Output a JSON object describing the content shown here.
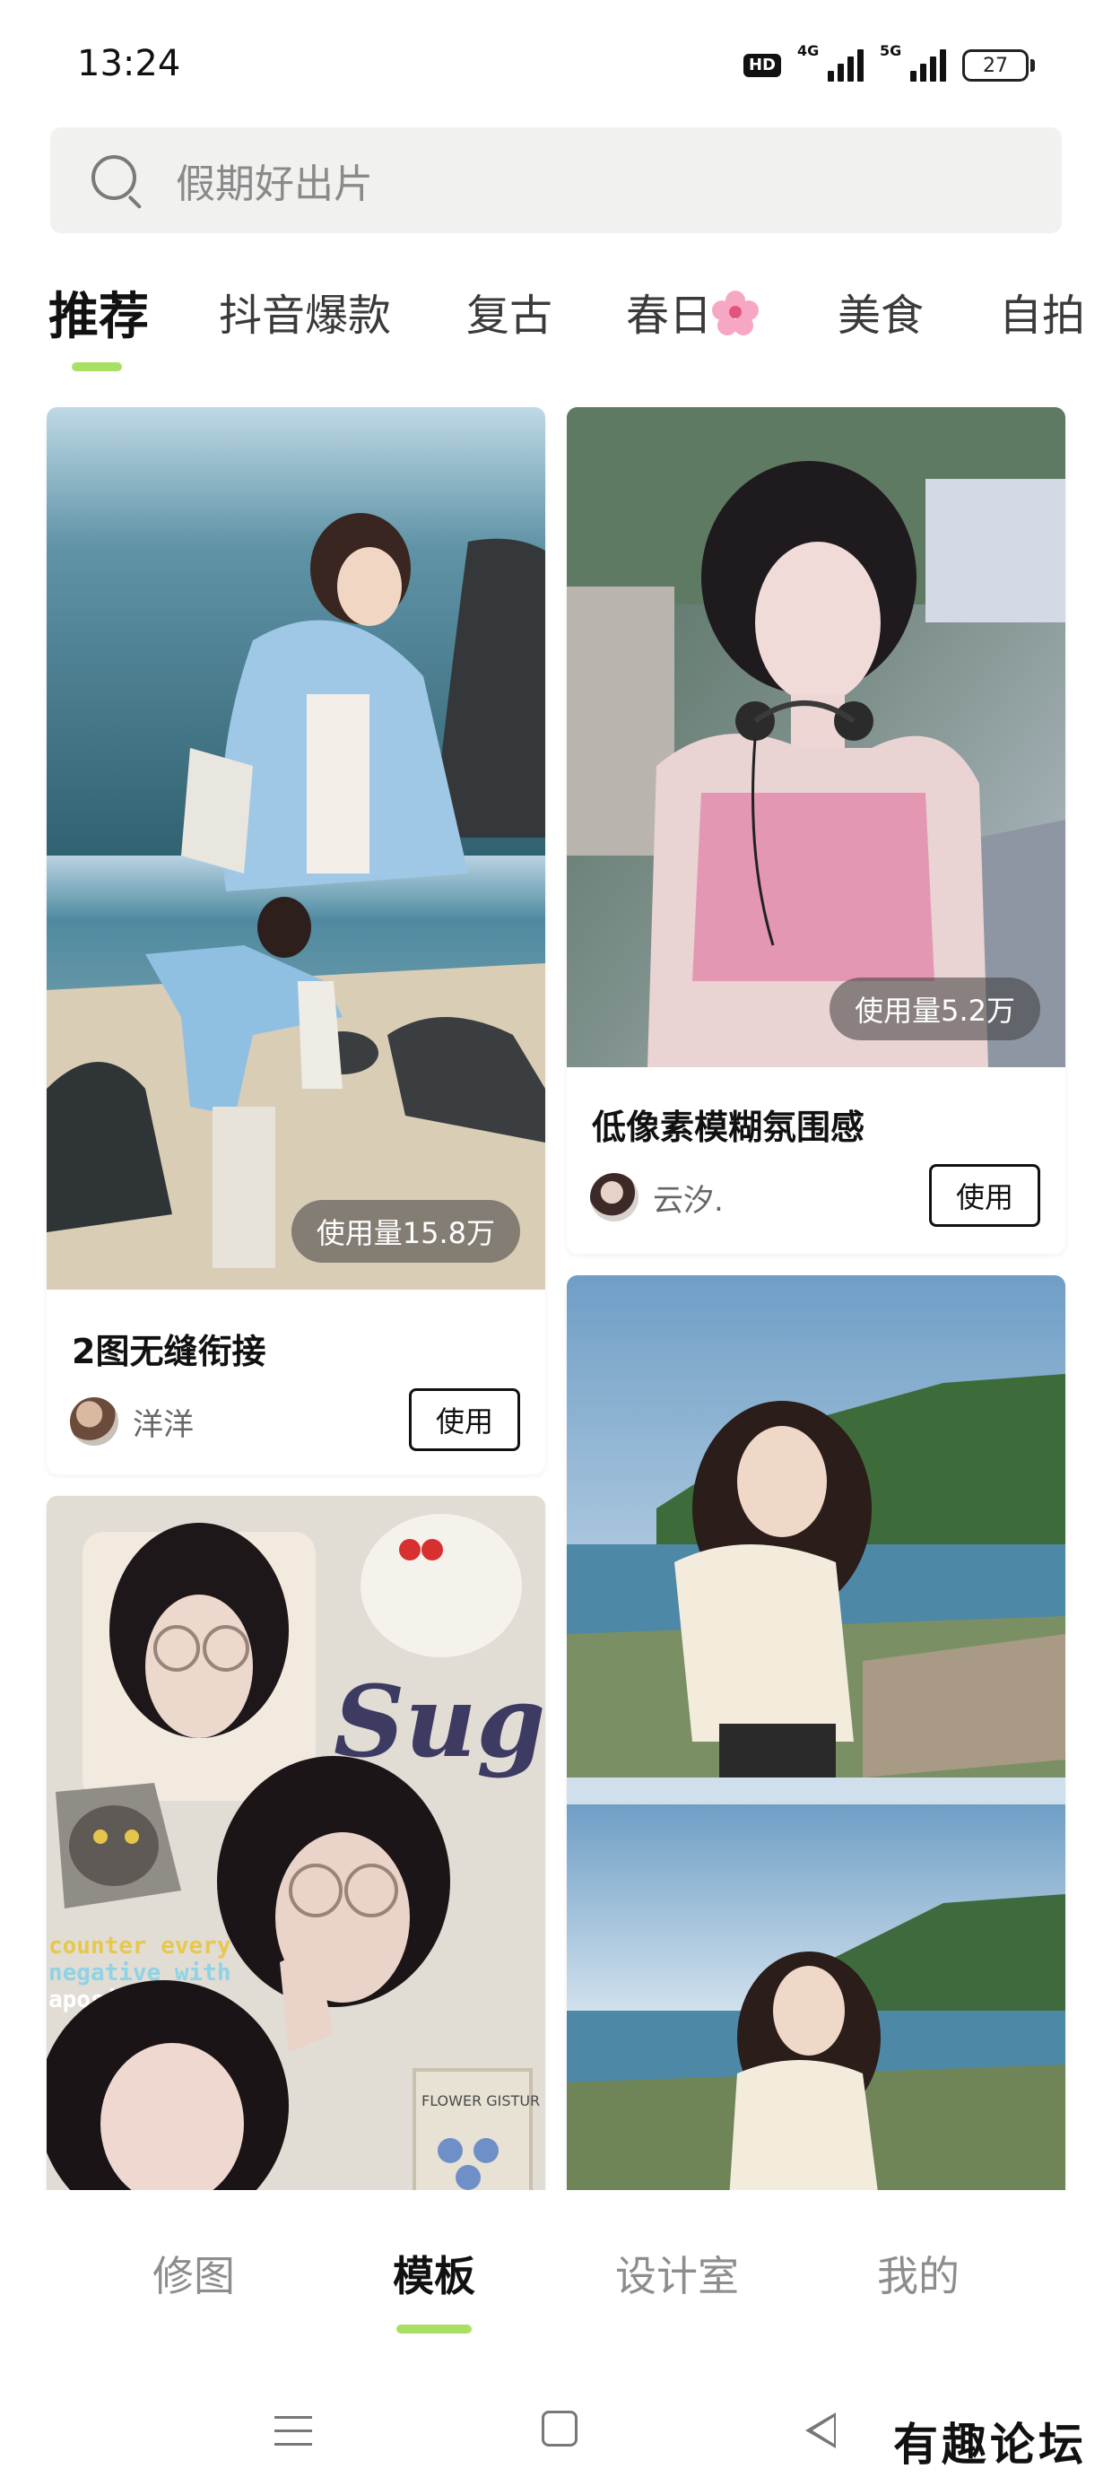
{
  "status_bar": {
    "time": "13:24",
    "hd_label": "HD",
    "network_1": "4G",
    "network_2": "5G",
    "battery": "27"
  },
  "search": {
    "placeholder": "假期好出片",
    "icon": "search-icon"
  },
  "tabs": [
    {
      "label": "推荐",
      "active": true
    },
    {
      "label": "抖音爆款"
    },
    {
      "label": "复古"
    },
    {
      "label": "春日",
      "emoji": "cherry-blossom-icon"
    },
    {
      "label": "美食"
    },
    {
      "label": "自拍"
    }
  ],
  "feed": {
    "cards": [
      {
        "usage": "使用量15.8万",
        "title": "2图无缝衔接",
        "author": "洋洋",
        "button": "使用"
      },
      {
        "usage": "使用量5.2万",
        "title": "低像素模糊氛围感",
        "author": "云汐.",
        "button": "使用"
      },
      {
        "image_text": [
          "Suga",
          "counter every",
          "negative with",
          "apositive",
          "FLOWER GISTUR"
        ]
      },
      {}
    ]
  },
  "bottom_nav": {
    "items": [
      {
        "label": "修图"
      },
      {
        "label": "模板",
        "active": true
      },
      {
        "label": "设计室"
      },
      {
        "label": "我的"
      }
    ]
  },
  "watermark": "有趣论坛",
  "colors": {
    "accent": "#a8e063",
    "search_bg": "#f1f1ef",
    "inactive_text": "#8d8d8d"
  }
}
